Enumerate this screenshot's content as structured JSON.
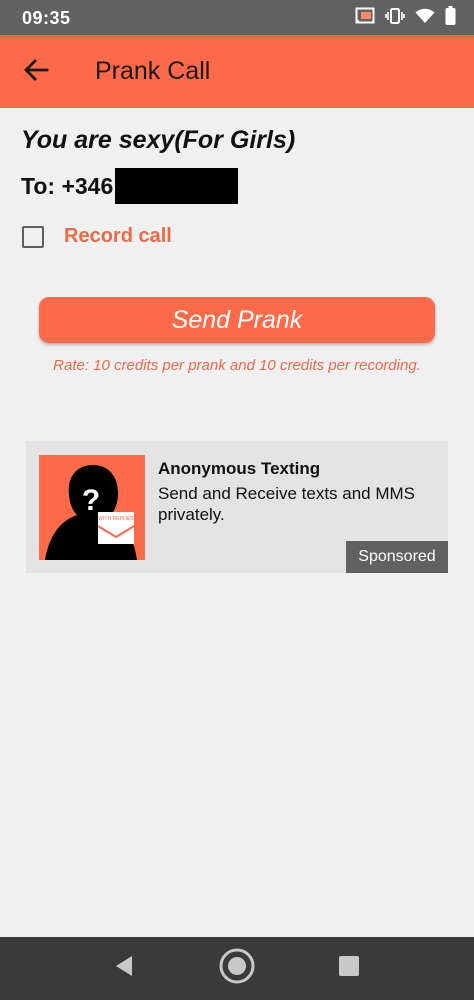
{
  "status_bar": {
    "time": "09:35",
    "icons": [
      "cast-icon",
      "vibrate-icon",
      "wifi-icon",
      "battery-icon"
    ]
  },
  "app_bar": {
    "title": "Prank Call",
    "back_icon": "arrow-left-icon",
    "color": "#fd6a4a"
  },
  "prank": {
    "title": "You are sexy(For Girls)",
    "to_label": "To: +346"
  },
  "record_call": {
    "label": "Record call",
    "checked": false
  },
  "send_button": {
    "label": "Send Prank"
  },
  "rate_note": "Rate: 10 credits per prank and 10 credits per recording.",
  "ad": {
    "title": "Anonymous Texting",
    "body": "Send and Receive texts and MMS privately.",
    "sponsored": "Sponsored",
    "image_text": "WITH REPLIES"
  },
  "nav_bar": {
    "icons": [
      "back-triangle-icon",
      "home-circle-icon",
      "recents-square-icon"
    ]
  },
  "colors": {
    "accent": "#fd6a4a",
    "accent_text": "#ea6a4a",
    "status_bar": "#616161",
    "nav_bar": "#3a3a3a"
  }
}
